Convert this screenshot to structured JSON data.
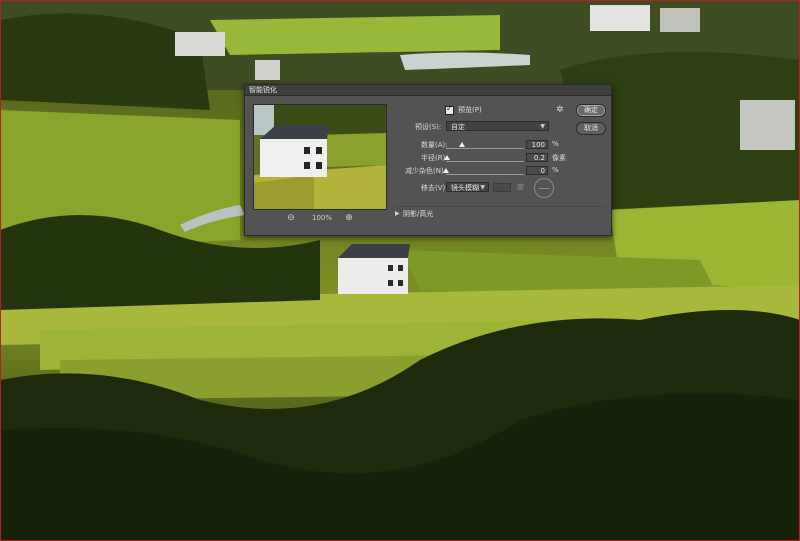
{
  "dialog": {
    "title": "智能锐化",
    "preview_checkbox": {
      "label": "预览(P)",
      "checked": true
    },
    "preset": {
      "label": "预设(S):",
      "value": "自定"
    },
    "amount": {
      "label": "数量(A):",
      "value": "100",
      "unit": "%",
      "level": 0.2
    },
    "radius": {
      "label": "半径(R):",
      "value": "0.2",
      "unit": "像素",
      "level": 0.01
    },
    "reduce_noise": {
      "label": "减少杂色(N):",
      "value": "0",
      "unit": "%",
      "level": 0.0
    },
    "remove": {
      "label": "移去(V):",
      "value": "镜头模糊",
      "angle_unit": "度"
    },
    "shadows_highlights": "阴影/高光",
    "zoom": "100%",
    "buttons": {
      "ok": "确定",
      "cancel": "取消"
    },
    "icons": {
      "zoom_out": "zoom-out-icon",
      "zoom_in": "zoom-in-icon",
      "gear": "gear-icon",
      "expand": "disclosure-triangle-icon",
      "angle": "angle-dial-icon"
    }
  }
}
